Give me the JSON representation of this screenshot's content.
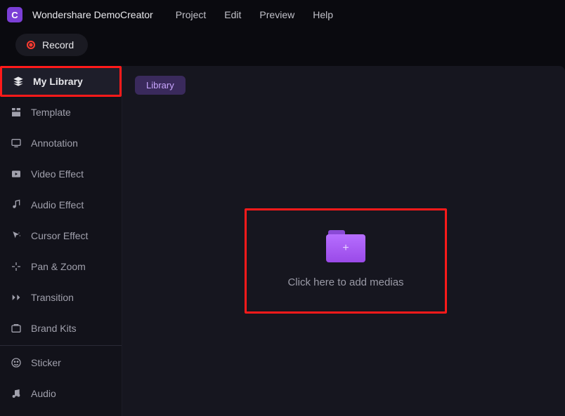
{
  "app": {
    "title": "Wondershare DemoCreator",
    "logo_letter": "C"
  },
  "menu": {
    "items": [
      "Project",
      "Edit",
      "Preview",
      "Help"
    ]
  },
  "toolbar": {
    "record_label": "Record"
  },
  "sidebar": {
    "items": [
      {
        "label": "My Library",
        "icon": "layers-icon",
        "active": true
      },
      {
        "label": "Template",
        "icon": "template-icon"
      },
      {
        "label": "Annotation",
        "icon": "annotation-icon"
      },
      {
        "label": "Video Effect",
        "icon": "video-effect-icon"
      },
      {
        "label": "Audio Effect",
        "icon": "audio-effect-icon"
      },
      {
        "label": "Cursor Effect",
        "icon": "cursor-effect-icon"
      },
      {
        "label": "Pan & Zoom",
        "icon": "pan-zoom-icon"
      },
      {
        "label": "Transition",
        "icon": "transition-icon"
      },
      {
        "label": "Brand Kits",
        "icon": "brand-kits-icon"
      },
      {
        "label": "Sticker",
        "icon": "sticker-icon"
      },
      {
        "label": "Audio",
        "icon": "audio-icon"
      }
    ]
  },
  "main": {
    "tab_label": "Library",
    "drop_text": "Click here to add medias"
  }
}
